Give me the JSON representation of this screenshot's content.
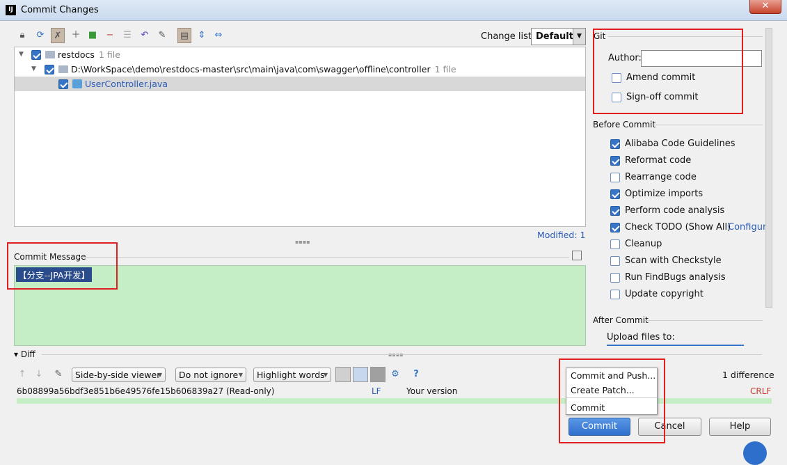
{
  "window": {
    "title": "Commit Changes",
    "app_icon_text": "IJ"
  },
  "toolbar": {
    "changelist_label": "Change list:",
    "changelist_value": "Default"
  },
  "tree": {
    "root": {
      "name": "restdocs",
      "count": "1 file"
    },
    "dir": {
      "path": "D:\\WorkSpace\\demo\\restdocs-master\\src\\main\\java\\com\\swagger\\offline\\controller",
      "count": "1 file"
    },
    "file": {
      "name": "UserController.java"
    }
  },
  "modified": "Modified: 1",
  "commit_message": {
    "label": "Commit Message",
    "text": "【分支--JPA开发】"
  },
  "diff": {
    "label": "Diff",
    "viewer": "Side-by-side viewer",
    "ignore": "Do not ignore",
    "highlight": "Highlight words",
    "hash": "6b08899a56bdf3e851b6e49576fe15b606839a27 (Read-only)",
    "left_eol": "LF",
    "your_version": "Your version",
    "right_eol": "CRLF",
    "differences": "1 difference"
  },
  "git": {
    "title": "Git",
    "author_label": "Author:",
    "author_value": "",
    "amend": "Amend commit",
    "signoff": "Sign-off commit"
  },
  "before_commit": {
    "title": "Before Commit",
    "items": [
      {
        "label": "Alibaba Code Guidelines",
        "checked": true
      },
      {
        "label": "Reformat code",
        "checked": true
      },
      {
        "label": "Rearrange code",
        "checked": false
      },
      {
        "label": "Optimize imports",
        "checked": true
      },
      {
        "label": "Perform code analysis",
        "checked": true
      },
      {
        "label": "Check TODO (Show All)",
        "checked": true
      },
      {
        "label": "Cleanup",
        "checked": false
      },
      {
        "label": "Scan with Checkstyle",
        "checked": false
      },
      {
        "label": "Run FindBugs analysis",
        "checked": false
      },
      {
        "label": "Update copyright",
        "checked": false
      }
    ],
    "configure_link": "Configure"
  },
  "after_commit": {
    "title": "After Commit",
    "upload_label": "Upload files to:"
  },
  "popup": {
    "items": [
      "Commit and Push...",
      "Create Patch...",
      "Commit"
    ]
  },
  "buttons": {
    "commit": "Commit",
    "cancel": "Cancel",
    "help": "Help"
  },
  "colors": {
    "accent": "#3574c7",
    "highlight_red": "#e02020",
    "message_bg": "#c6eec6"
  }
}
